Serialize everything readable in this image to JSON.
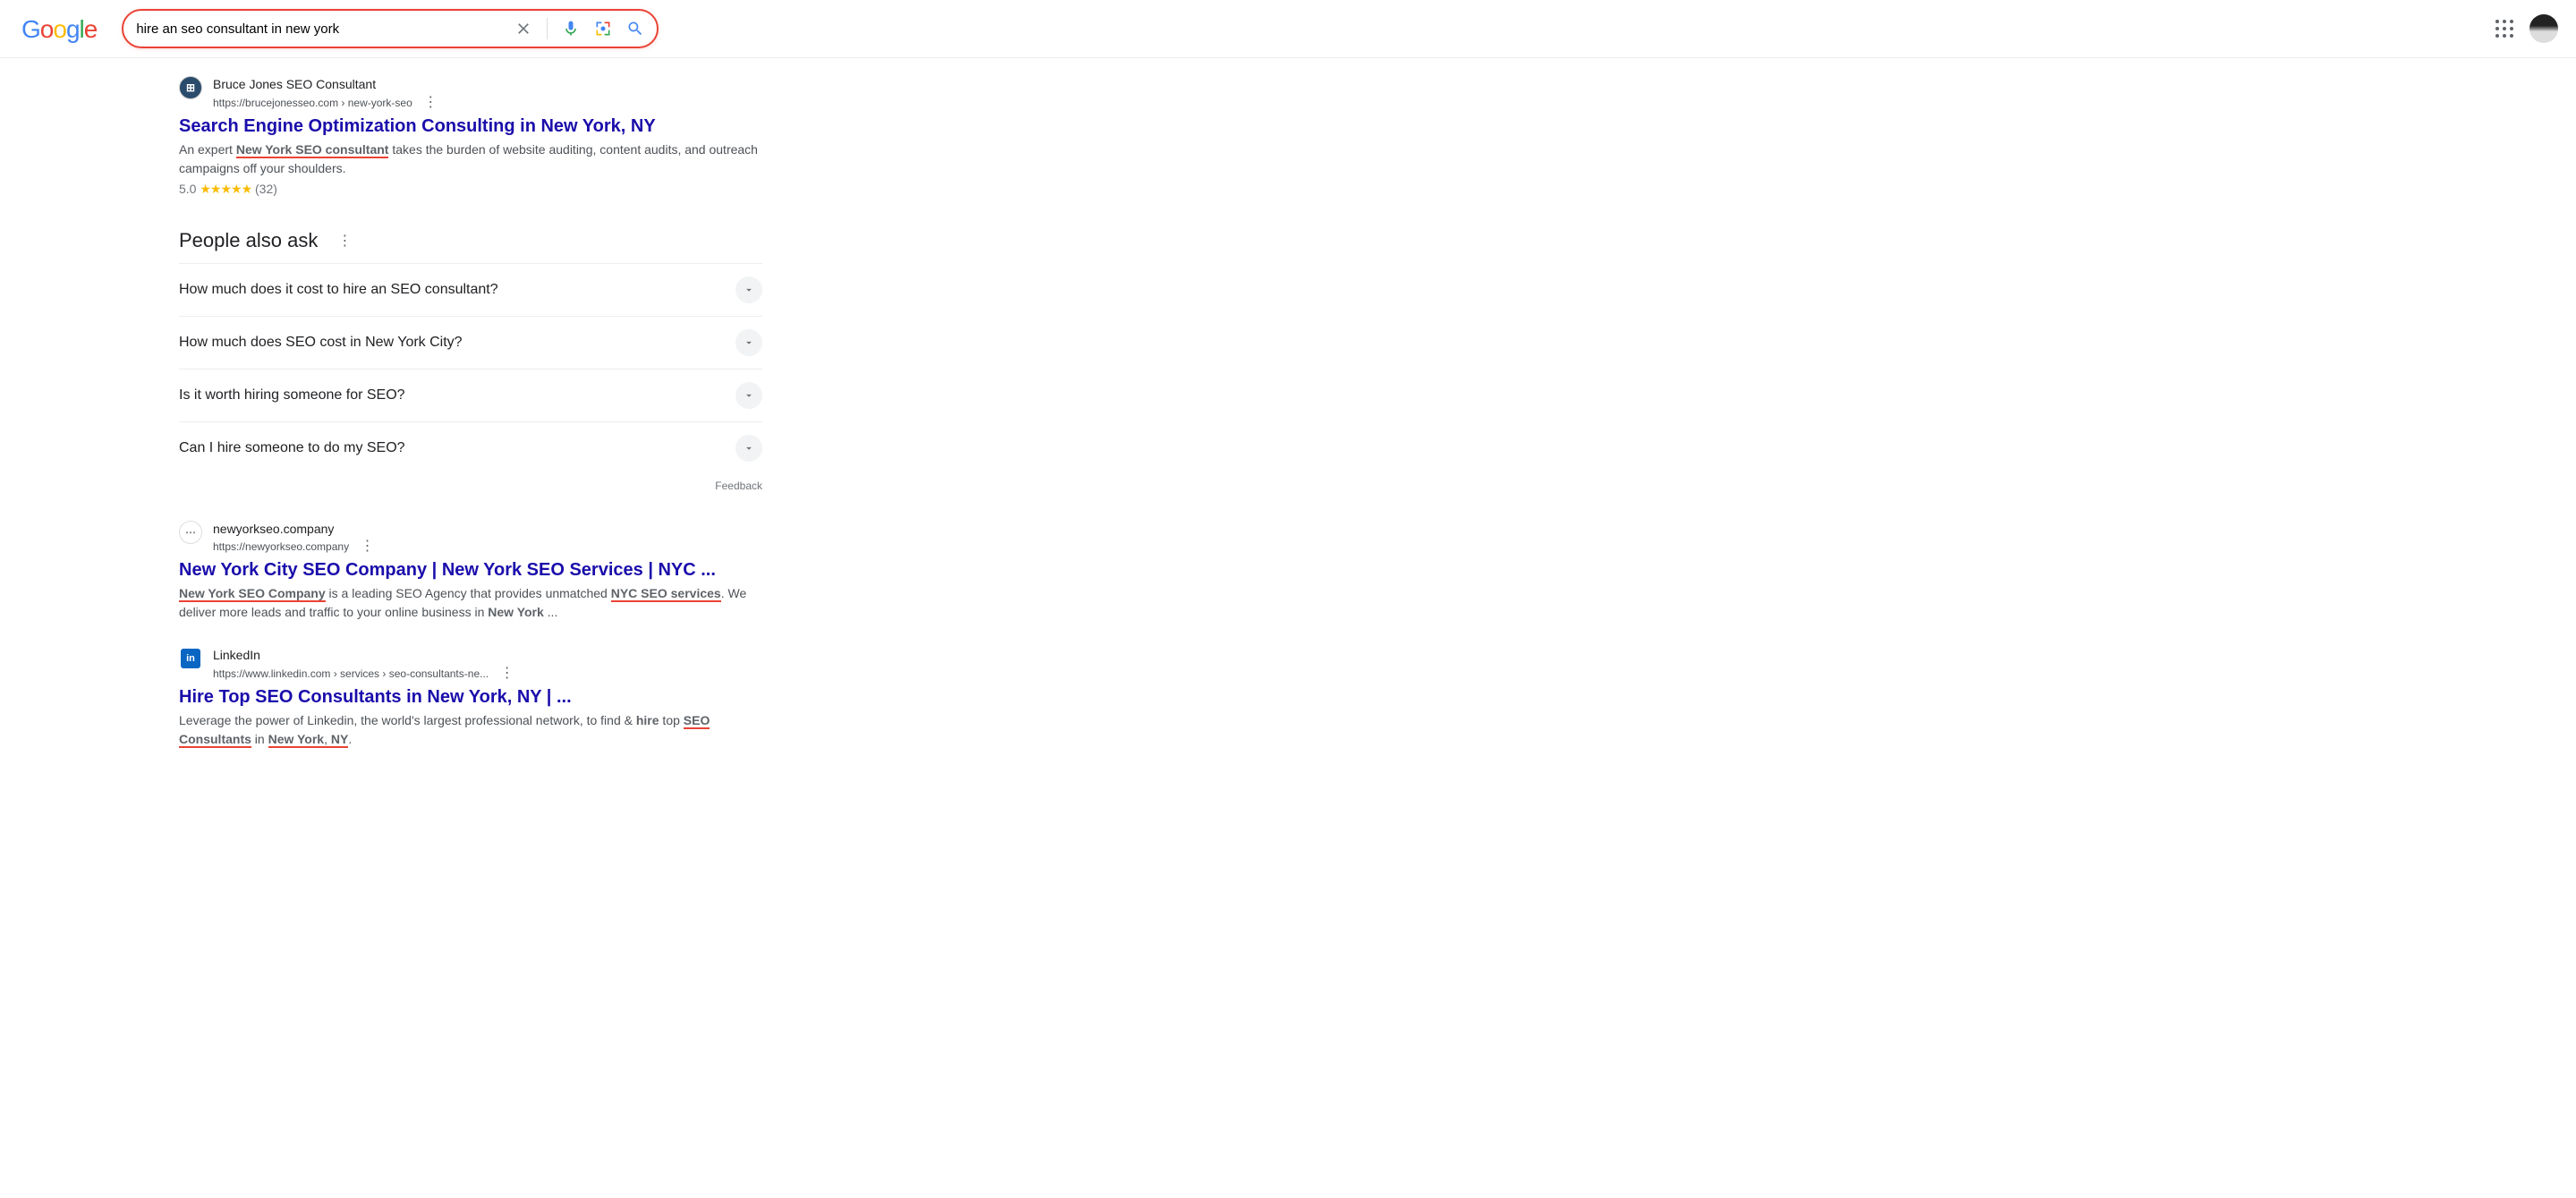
{
  "search": {
    "query": "hire an seo consultant in new york"
  },
  "results": [
    {
      "favicon_class": "fav1",
      "favicon_text": "⊞",
      "site": "Bruce Jones SEO Consultant",
      "url": "https://brucejonesseo.com › new-york-seo",
      "title": "Search Engine Optimization Consulting in New York, NY",
      "snip_pre": "An expert ",
      "snip_ul": "New York SEO consultant",
      "snip_post": " takes the burden of website auditing, content audits, and outreach campaigns off your shoulders.",
      "rating_value": "5.0",
      "rating_stars": "★★★★★",
      "rating_count": "(32)"
    },
    {
      "favicon_class": "fav2",
      "favicon_text": "⋯",
      "site": "newyorkseo.company",
      "url": "https://newyorkseo.company",
      "title": "New York City SEO Company | New York SEO Services | NYC ...",
      "snippet_html": "<span class='ul-red'><b>New York SEO Company</b></span> is a leading SEO Agency that provides unmatched <span class='ul-red'><b>NYC SEO services</b></span>. We deliver more leads and traffic to your online business in <b>New York</b> ..."
    },
    {
      "favicon_class": "fav3",
      "favicon_text": "in",
      "site": "LinkedIn",
      "url": "https://www.linkedin.com › services › seo-consultants-ne...",
      "title": "Hire Top SEO Consultants in New York, NY | ...",
      "snippet_html": "Leverage the power of Linkedin, the world's largest professional network, to find & <b>hire</b> top <span class='ul-red'><b>SEO Consultants</b></span> in <span class='ul-red'><b>New York</b>, <b>NY</b></span>."
    }
  ],
  "paa": {
    "heading": "People also ask",
    "items": [
      "How much does it cost to hire an SEO consultant?",
      "How much does SEO cost in New York City?",
      "Is it worth hiring someone for SEO?",
      "Can I hire someone to do my SEO?"
    ],
    "feedback": "Feedback"
  }
}
